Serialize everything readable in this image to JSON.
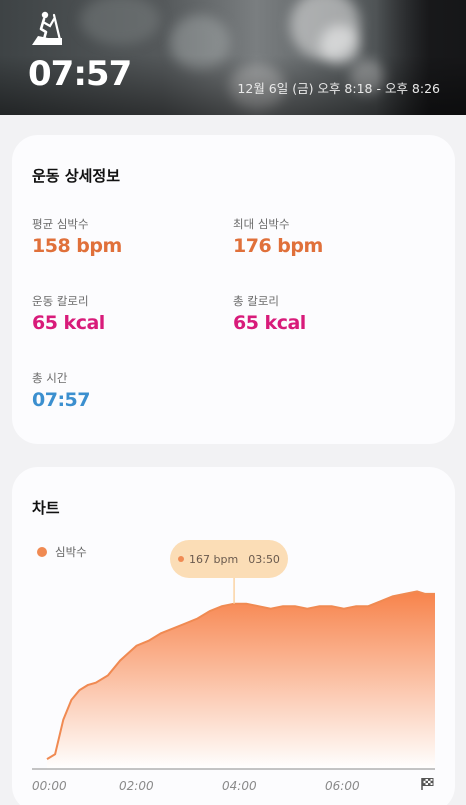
{
  "header": {
    "duration": "07:57",
    "date_range": "12월 6일 (금) 오후 8:18 - 오후 8:26",
    "activity_icon": "elliptical-trainer-icon"
  },
  "details": {
    "title": "운동 상세정보",
    "avg_hr": {
      "label": "평균 심박수",
      "value": "158 bpm"
    },
    "max_hr": {
      "label": "최대 심박수",
      "value": "176 bpm"
    },
    "workout_calories": {
      "label": "운동 칼로리",
      "value": "65 kcal"
    },
    "total_calories": {
      "label": "총 칼로리",
      "value": "65 kcal"
    },
    "total_time": {
      "label": "총 시간",
      "value": "07:57"
    }
  },
  "colors": {
    "orange": "#e0703a",
    "pink": "#d81b7a",
    "blue": "#3b8fcf",
    "series": "#f08a52"
  },
  "chart": {
    "title": "차트",
    "legend": "심박수",
    "tooltip_value": "167 bpm",
    "tooltip_time": "03:50",
    "end_icon": "checkered-flag-icon"
  },
  "chart_data": {
    "type": "area",
    "title": "차트",
    "xlabel": "",
    "ylabel": "",
    "x_tick_labels": [
      "00:00",
      "02:00",
      "04:00",
      "06:00"
    ],
    "xlim_seconds": [
      0,
      477
    ],
    "ylim": [
      100,
      190
    ],
    "series": [
      {
        "name": "심박수",
        "x_seconds": [
          0,
          10,
          20,
          30,
          40,
          50,
          60,
          75,
          90,
          100,
          110,
          125,
          140,
          155,
          170,
          185,
          200,
          215,
          230,
          245,
          260,
          275,
          290,
          305,
          320,
          335,
          350,
          365,
          380,
          395,
          410,
          425,
          440,
          455,
          465,
          477
        ],
        "values": [
          104,
          106,
          120,
          128,
          132,
          134,
          135,
          138,
          144,
          147,
          150,
          152,
          155,
          157,
          159,
          161,
          164,
          166,
          167,
          167,
          166,
          165,
          166,
          166,
          165,
          166,
          166,
          165,
          166,
          166,
          168,
          170,
          171,
          172,
          171,
          171
        ]
      }
    ],
    "annotation": {
      "x_seconds": 230,
      "label": "167 bpm 03:50"
    }
  }
}
